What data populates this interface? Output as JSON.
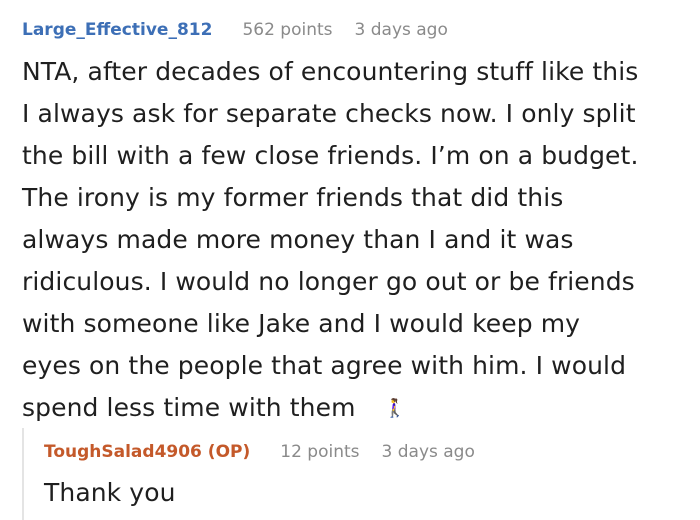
{
  "comment": {
    "username": "Large_Effective_812",
    "points": "562 points",
    "age": "3 days ago",
    "lines": [
      "NTA, after decades of encountering stuff like this",
      "I always ask for separate checks now. I only split",
      "the bill with a few close friends. I’m on a budget.",
      "The irony is my former friends that did this",
      "always made more money than I and it was",
      "ridiculous. I would no longer go out or be friends",
      "with someone like Jake and I would keep my",
      "eyes on the people that agree with him. I would",
      "spend less time with them"
    ],
    "emoji": "🚶‍♀️",
    "emoji_icon": "woman-walking-icon"
  },
  "reply": {
    "username": "ToughSalad4906 (OP)",
    "points": "12 points",
    "age": "3 days ago",
    "text": "Thank you"
  },
  "colors": {
    "username": "#3d6fb6",
    "op_username": "#c4592a",
    "meta": "#8a8a8a",
    "text": "#1f1f1f",
    "thread_line": "#e4e4e4"
  }
}
